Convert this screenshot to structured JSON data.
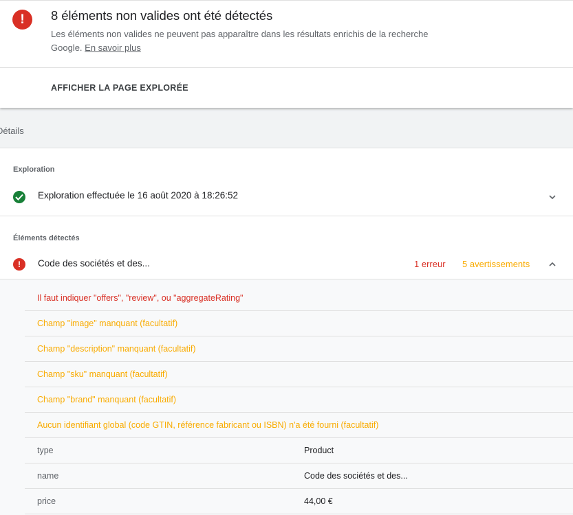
{
  "header": {
    "title": "8 éléments non valides ont été détectés",
    "description": "Les éléments non valides ne peuvent pas apparaître dans les résultats enrichis de la recherche Google.",
    "learn_more": "En savoir plus",
    "view_page_button": "AFFICHER LA PAGE EXPLORÉE"
  },
  "details_label": "Détails",
  "crawl": {
    "section_label": "Exploration",
    "status_text": "Exploration effectuée le 16 août 2020 à 18:26:52"
  },
  "detected": {
    "section_label": "Éléments détectés",
    "item_name": "Code des sociétés et des...",
    "error_count": "1 erreur",
    "warning_count": "5 avertissements"
  },
  "issues": [
    {
      "severity": "error",
      "text": "Il faut indiquer \"offers\", \"review\", ou \"aggregateRating\""
    },
    {
      "severity": "warning",
      "text": "Champ \"image\" manquant (facultatif)"
    },
    {
      "severity": "warning",
      "text": "Champ \"description\" manquant (facultatif)"
    },
    {
      "severity": "warning",
      "text": "Champ \"sku\" manquant (facultatif)"
    },
    {
      "severity": "warning",
      "text": "Champ \"brand\" manquant (facultatif)"
    },
    {
      "severity": "warning",
      "text": "Aucun identifiant global (code GTIN, référence fabricant ou ISBN) n'a été fourni (facultatif)"
    }
  ],
  "properties": [
    {
      "key": "type",
      "value": "Product"
    },
    {
      "key": "name",
      "value": "Code des sociétés et des..."
    },
    {
      "key": "price",
      "value": "44,00 €"
    }
  ],
  "colors": {
    "error": "#d93025",
    "warning": "#f9ab00",
    "success": "#188038"
  }
}
